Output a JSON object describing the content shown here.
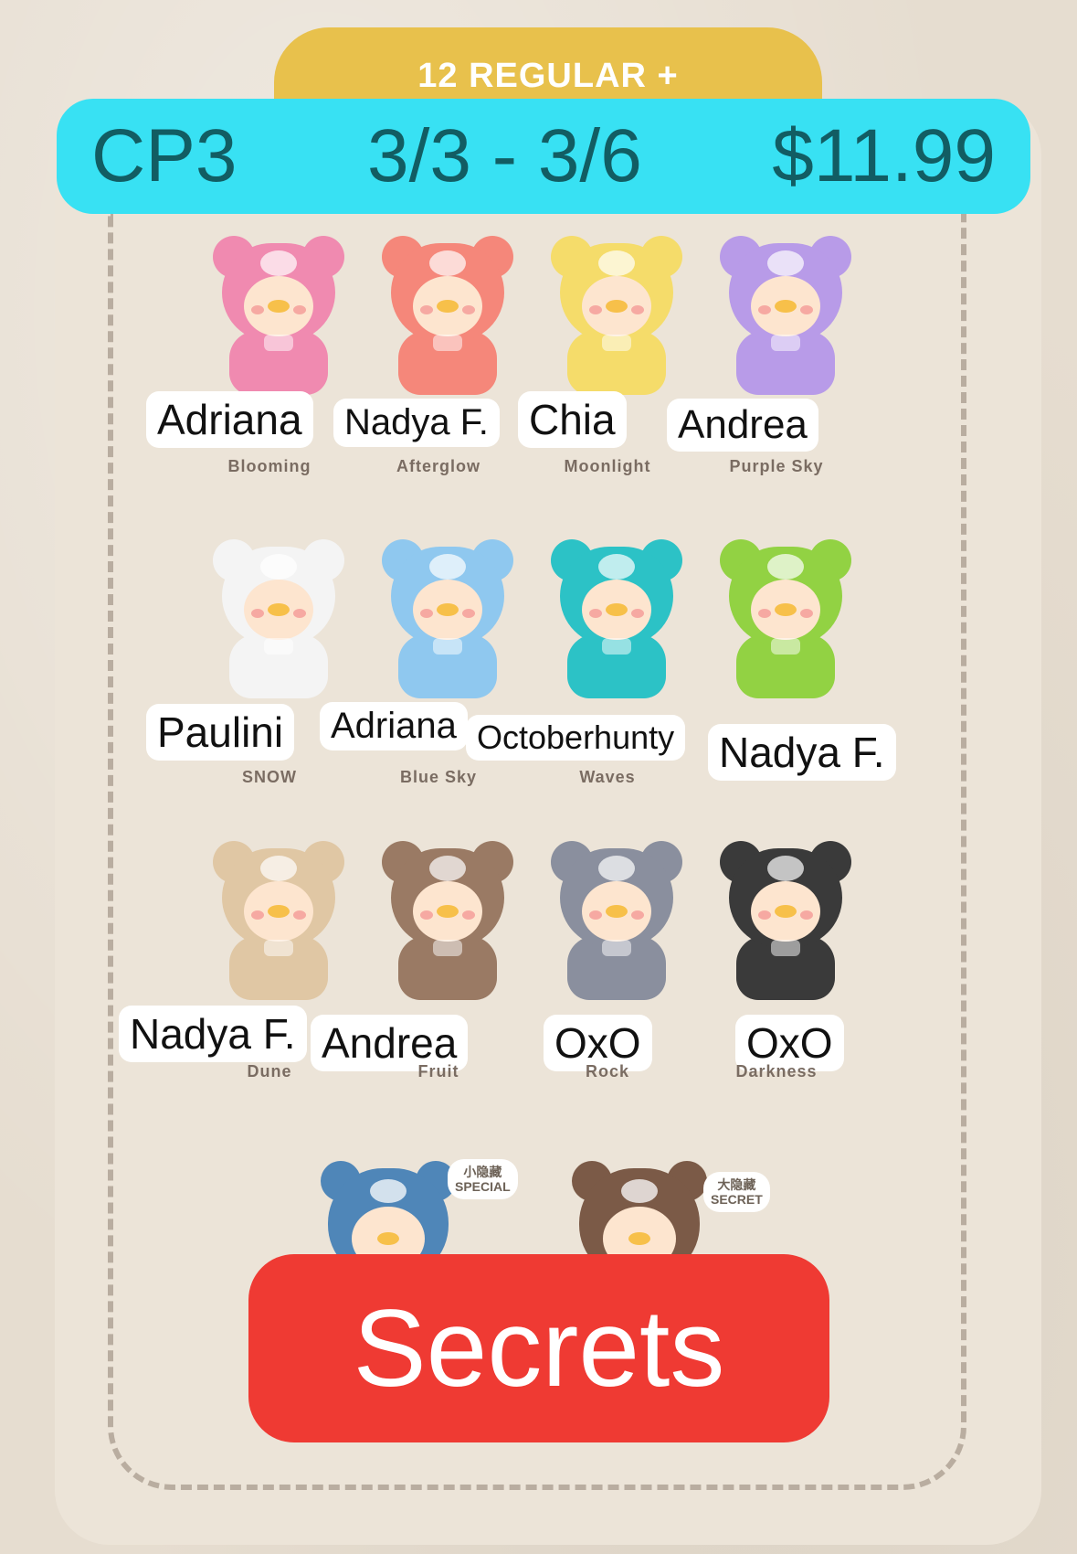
{
  "tab": {
    "label": "12 REGULAR +"
  },
  "header": {
    "code": "CP3",
    "dates": "3/3 - 3/6",
    "price": "$11.99"
  },
  "items": [
    {
      "name": "Adriana",
      "series": "Blooming",
      "color": "#f08ab0"
    },
    {
      "name": "Nadya F.",
      "series": "Afterglow",
      "color": "#f5877a"
    },
    {
      "name": "Chia",
      "series": "Moonlight",
      "color": "#f5dc6a"
    },
    {
      "name": "Andrea",
      "series": "Purple Sky",
      "color": "#b89be8"
    },
    {
      "name": "Paulini",
      "series": "SNOW",
      "color": "#f4f4f4"
    },
    {
      "name": "Adriana",
      "series": "Blue Sky",
      "color": "#8fc8ef"
    },
    {
      "name": "Octoberhunty",
      "series": "Waves",
      "color": "#2cc2c6"
    },
    {
      "name": "Nadya F.",
      "series": "",
      "color": "#92d243"
    },
    {
      "name": "Nadya F.",
      "series": "Dune",
      "color": "#e0c7a4"
    },
    {
      "name": "Andrea",
      "series": "Fruit",
      "color": "#9a7a64"
    },
    {
      "name": "OxO",
      "series": "Rock",
      "color": "#8a8f9e"
    },
    {
      "name": "OxO",
      "series": "Darkness",
      "color": "#3a3a3a"
    }
  ],
  "secrets": {
    "special_label_cn": "小隐藏",
    "special_label": "SPECIAL",
    "secret_label_cn": "大隐藏",
    "secret_label": "SECRET",
    "special_color": "#4f86b8",
    "secret_color": "#7b5a47",
    "button": "Secrets"
  },
  "colors": {
    "header_bg": "#38e1f3",
    "header_text": "#125d63",
    "button_bg": "#ef3a33",
    "tab_bg": "#e8c14c"
  }
}
